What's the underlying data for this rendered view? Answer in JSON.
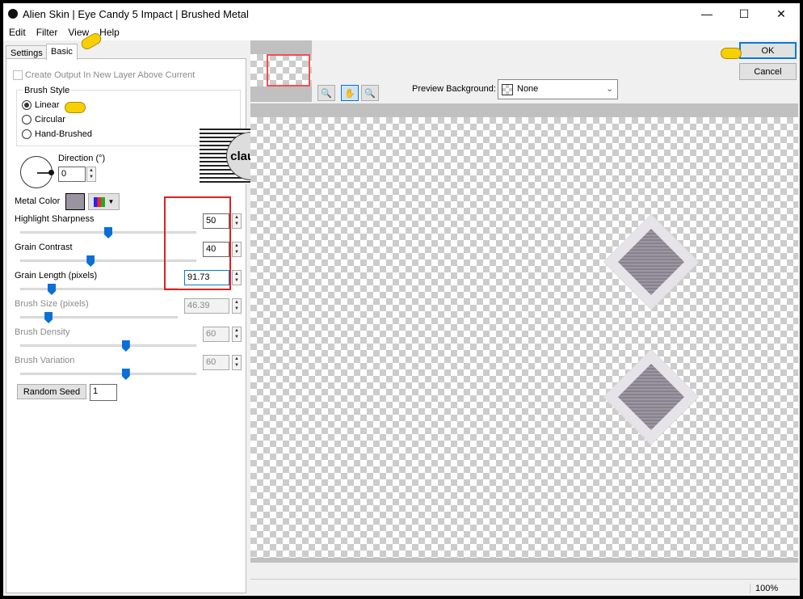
{
  "window": {
    "title": "Alien Skin | Eye Candy 5 Impact | Brushed Metal",
    "controls": [
      "minimize",
      "maximize",
      "close"
    ]
  },
  "menu": [
    "Edit",
    "Filter",
    "View",
    "Help"
  ],
  "tabs": [
    {
      "label": "Settings",
      "active": false
    },
    {
      "label": "Basic",
      "active": true
    }
  ],
  "basic": {
    "create_output_label": "Create Output In New Layer Above Current",
    "create_output_checked": false,
    "brush_style": {
      "label": "Brush Style",
      "options": [
        "Linear",
        "Circular",
        "Hand-Brushed"
      ],
      "selected": "Linear"
    },
    "direction": {
      "label": "Direction (°)",
      "value": "0"
    },
    "metal_color": {
      "label": "Metal Color",
      "color": "#9a94a0"
    },
    "sliders": [
      {
        "label": "Highlight Sharpness",
        "value": "50",
        "slider_pct": 50,
        "enabled": true
      },
      {
        "label": "Grain Contrast",
        "value": "40",
        "slider_pct": 40,
        "enabled": true
      },
      {
        "label": "Grain Length (pixels)",
        "value": "91.73",
        "slider_pct": 20,
        "enabled": true
      },
      {
        "label": "Brush Size (pixels)",
        "value": "46.39",
        "slider_pct": 18,
        "enabled": false
      },
      {
        "label": "Brush Density",
        "value": "60",
        "slider_pct": 60,
        "enabled": false
      },
      {
        "label": "Brush Variation",
        "value": "60",
        "slider_pct": 60,
        "enabled": false
      }
    ],
    "random_seed": {
      "label": "Random Seed",
      "value": "1"
    }
  },
  "buttons": {
    "ok": "OK",
    "cancel": "Cancel"
  },
  "preview": {
    "background_label": "Preview Background:",
    "background_value": "None",
    "zoom": "100%"
  },
  "watermark": "claudia",
  "colors": {
    "highlight_box": "#e02020",
    "accent": "#0a6fd6"
  }
}
